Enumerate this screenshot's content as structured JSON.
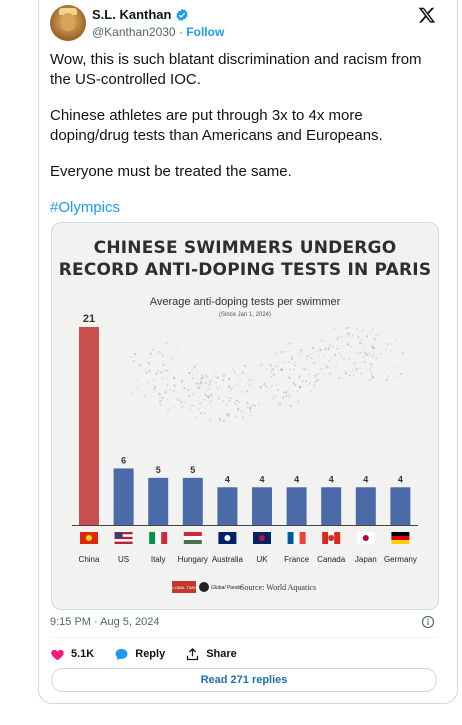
{
  "author": {
    "name": "S.L. Kanthan",
    "handle": "@Kanthan2030",
    "follow_label": "Follow"
  },
  "tweet": {
    "paragraphs": [
      "Wow, this is such blatant discrimination and racism from the US-controlled IOC.",
      "Chinese athletes are put through 3x to 4x more doping/drug tests than Americans and Europeans.",
      "Everyone must be treated the same."
    ],
    "hashtag": "#Olympics"
  },
  "image": {
    "title_line1": "CHINESE SWIMMERS UNDERGO",
    "title_line2": "RECORD ANTI-DOPING TESTS  IN PARIS",
    "subtitle": "Average anti-doping tests per swimmer",
    "since": "(Since Jan 1, 2024)",
    "source_text": "Source: World Aquatics",
    "logo_text_1": "GLOBAL TIMES",
    "logo_text_2": "Global Panda"
  },
  "chart_data": {
    "type": "bar",
    "categories": [
      "China",
      "US",
      "Italy",
      "Hungary",
      "Australia",
      "UK",
      "France",
      "Canada",
      "Japan",
      "Germany"
    ],
    "values": [
      21,
      6,
      5,
      5,
      4,
      4,
      4,
      4,
      4,
      4
    ],
    "title": "CHINESE SWIMMERS UNDERGO RECORD ANTI-DOPING TESTS  IN PARIS",
    "subtitle": "Average anti-doping tests per swimmer",
    "ylim": [
      0,
      21
    ],
    "colors": {
      "china": "#c94f4f",
      "others": "#4a6aa8"
    },
    "grid": false,
    "legend": "none"
  },
  "meta": {
    "timestamp": "9:15 PM · Aug 5, 2024"
  },
  "actions": {
    "likes": "5.1K",
    "reply_label": "Reply",
    "share_label": "Share"
  },
  "replies_button": "Read 271 replies",
  "colors": {
    "link": "#1d9bf0",
    "like": "#f91880",
    "text": "#0f1419",
    "muted": "#536471"
  },
  "icons": [
    "verified-badge-icon",
    "x-logo-icon",
    "info-icon",
    "heart-icon",
    "reply-bubble-icon",
    "share-icon"
  ]
}
